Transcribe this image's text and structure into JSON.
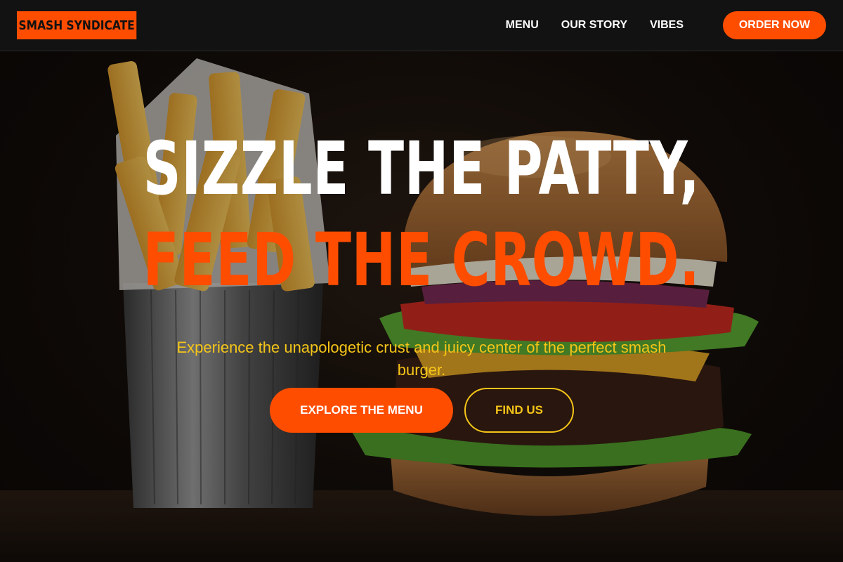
{
  "brand": {
    "logo_text": "SMASH SYNDICATE",
    "accent_color": "#ff4d00",
    "secondary_color": "#f5c518"
  },
  "nav": {
    "items": [
      {
        "label": "MENU"
      },
      {
        "label": "OUR STORY"
      },
      {
        "label": "VIBES"
      }
    ],
    "cta_label": "ORDER NOW"
  },
  "hero": {
    "headline_line1": "SIZZLE THE PATTY,",
    "headline_line2": "FEED THE CROWD.",
    "tagline": "Experience the unapologetic crust and juicy center of the perfect smash burger.",
    "primary_button": "EXPLORE THE MENU",
    "secondary_button": "FIND US",
    "image_subject": "burger-and-fries-photo"
  }
}
